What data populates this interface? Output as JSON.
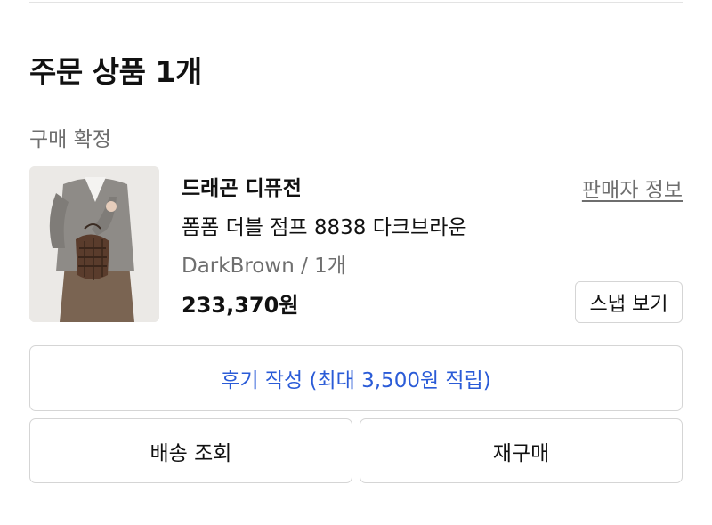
{
  "order": {
    "section_title": "주문 상품 1개",
    "status": "구매 확정"
  },
  "product": {
    "brand": "드래곤 디퓨전",
    "seller_info_label": "판매자 정보",
    "name": "폼폼 더블 점프 8838 다크브라운",
    "option": "DarkBrown / 1개",
    "price": "233,370원",
    "snap_button_label": "스냅 보기",
    "image_icon": "product-photo-bag-icon"
  },
  "actions": {
    "review_label": "후기 작성 (최대 3,500원 적립)",
    "delivery_label": "배송 조회",
    "reorder_label": "재구매"
  },
  "colors": {
    "accent": "#2a5bd7",
    "muted_text": "#6e6e6e",
    "border": "#d5d5d5"
  }
}
